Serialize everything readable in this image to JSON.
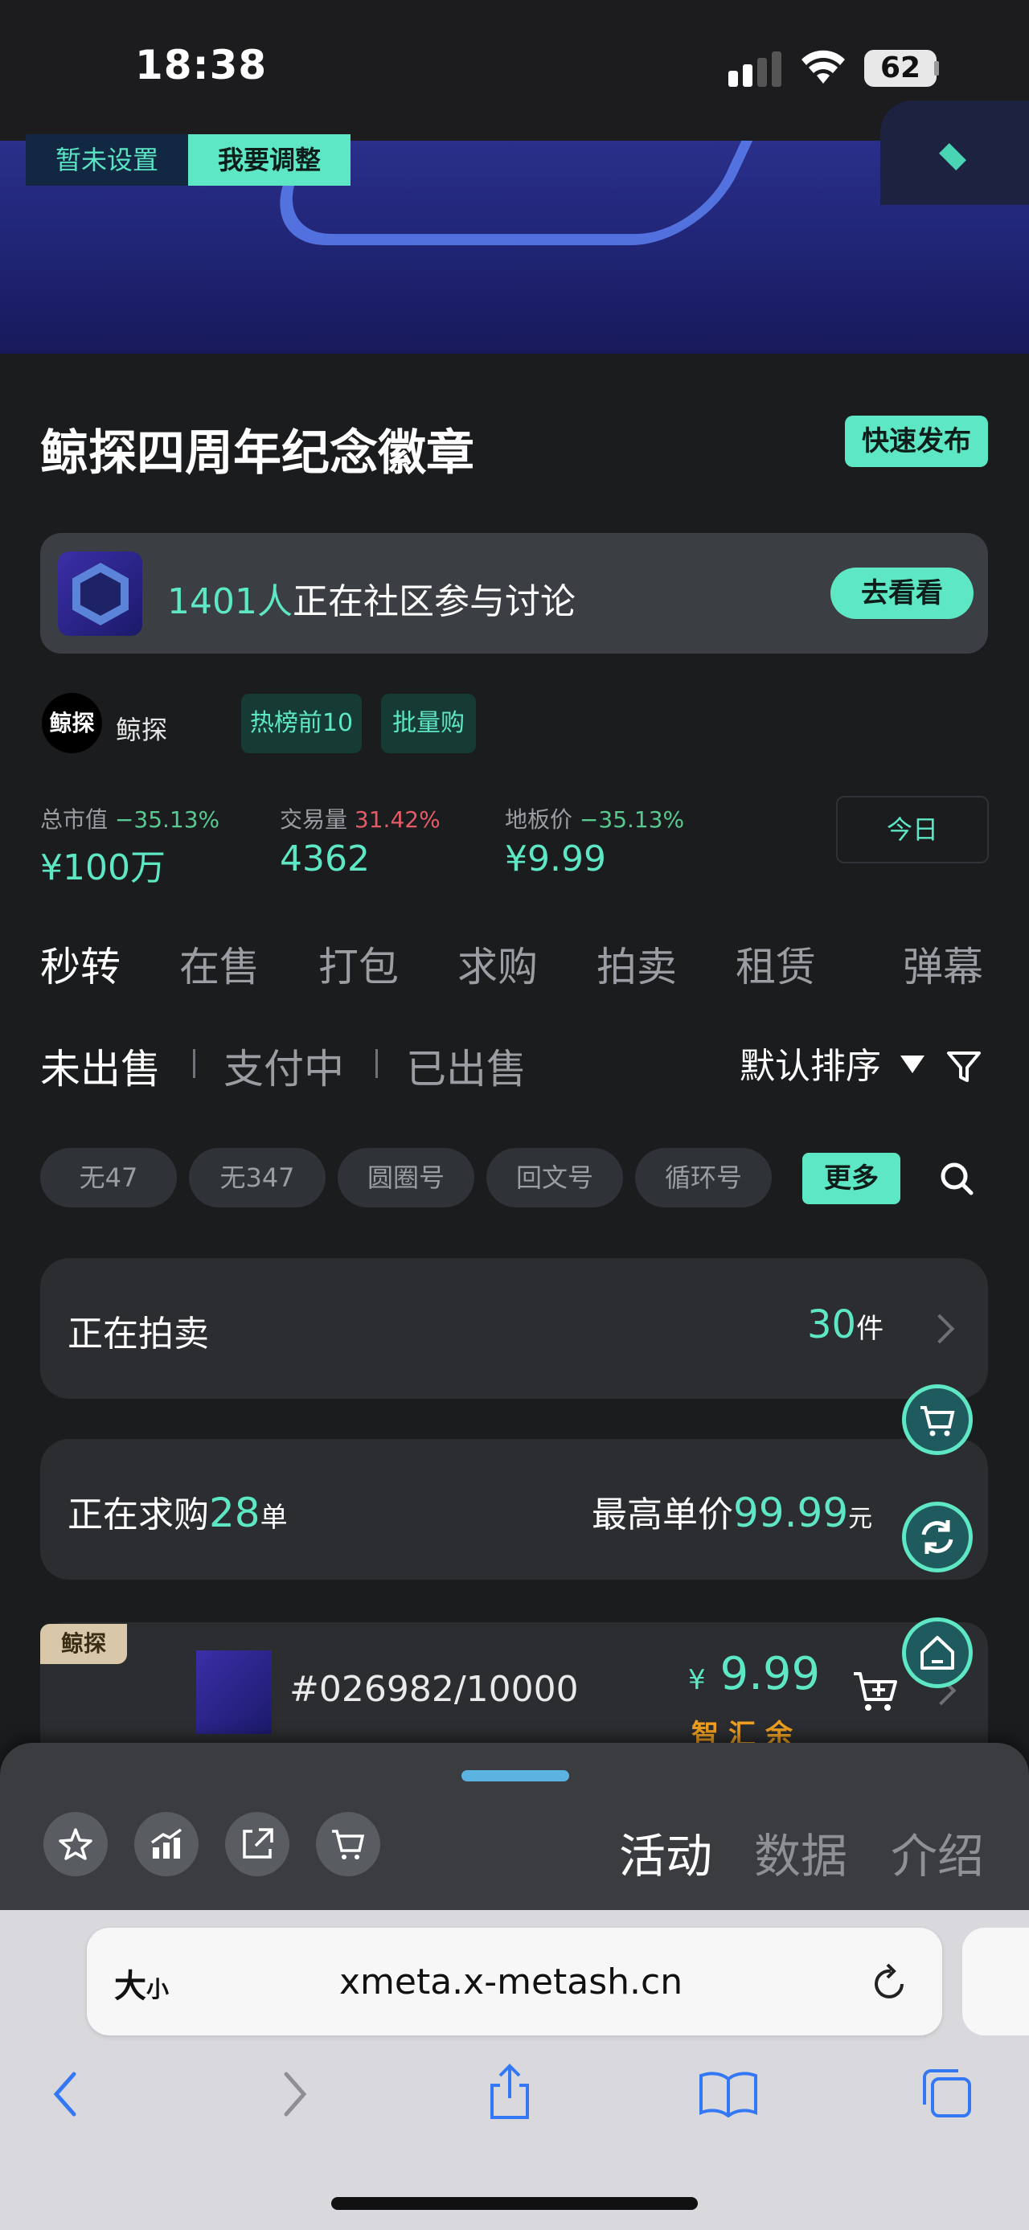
{
  "status_bar": {
    "time": "18:38",
    "battery": "62"
  },
  "banner": {
    "btn_not_set": "暂未设置",
    "btn_adjust": "我要调整"
  },
  "header": {
    "title": "鲸探四周年纪念徽章",
    "quick_publish": "快速发布"
  },
  "community": {
    "count": "1401人",
    "text": "正在社区参与讨论",
    "button": "去看看"
  },
  "creator": {
    "logo_text": "鲸探",
    "name": "鲸探",
    "tags": [
      "热榜前10",
      "批量购"
    ]
  },
  "stats": [
    {
      "label": "总市值",
      "change": "−35.13%",
      "value": "¥100万"
    },
    {
      "label": "交易量",
      "change": "31.42%",
      "value": "4362"
    },
    {
      "label": "地板价",
      "change": "−35.13%",
      "value": "¥9.99"
    }
  ],
  "today_button": "今日",
  "tabs": [
    "秒转",
    "在售",
    "打包",
    "求购",
    "拍卖",
    "租赁",
    "弹幕"
  ],
  "subtabs": [
    "未出售",
    "支付中",
    "已出售"
  ],
  "sort": "默认排序",
  "chips": [
    "无47",
    "无347",
    "圆圈号",
    "回文号",
    "循环号"
  ],
  "more": "更多",
  "auction": {
    "label": "正在拍卖",
    "count": "30",
    "unit": "件"
  },
  "wanted": {
    "label": "正在求购",
    "count": "28",
    "count_unit": "单",
    "max_label": "最高单价",
    "max_price": "99.99",
    "price_unit": "元"
  },
  "item": {
    "brand": "鲸探",
    "id": "#026982/10000",
    "currency": "¥",
    "price": "9.99",
    "sub": "智汇余"
  },
  "sheet_tabs": [
    "活动",
    "数据",
    "介绍"
  ],
  "browser": {
    "aa_big": "大",
    "aa_small": "小",
    "url": "xmeta.x-metash.cn"
  },
  "icons": [
    "signal-icon",
    "wifi-icon",
    "star-icon",
    "chart-icon",
    "share-icon",
    "cart-icon",
    "reload-icon",
    "back-icon",
    "forward-icon",
    "book-icon",
    "tabs-icon",
    "search-icon",
    "filter-icon"
  ]
}
